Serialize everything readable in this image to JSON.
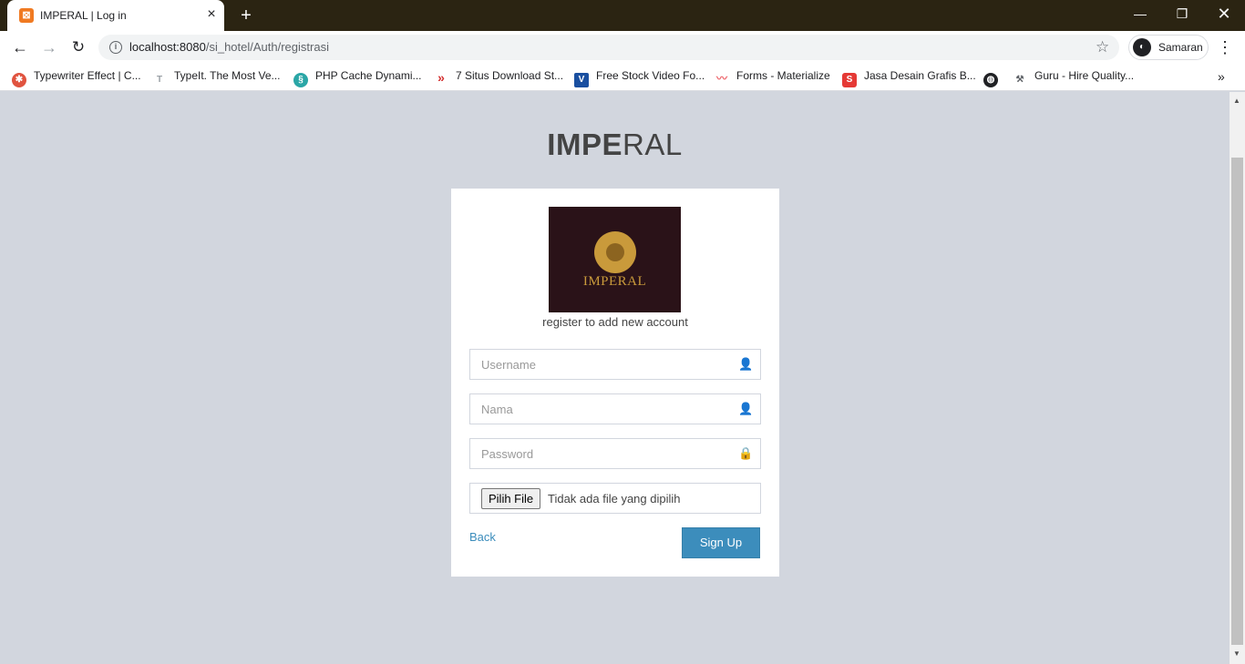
{
  "browser": {
    "tab_title": "IMPERAL | Log in",
    "tab_favicon": "xampp-icon",
    "url_host": "localhost:8080",
    "url_path": "/si_hotel/Auth/registrasi",
    "profile_label": "Samaran"
  },
  "bookmarks": [
    {
      "label": "Typewriter Effect | C...",
      "icon": "codepen-icon",
      "color": "#e0533f"
    },
    {
      "label": "TypeIt. The Most Ve...",
      "icon": "typeit-icon",
      "color": "#9aa0a6"
    },
    {
      "label": "PHP Cache Dynami...",
      "icon": "php-icon",
      "color": "#2aa6a6"
    },
    {
      "label": "7 Situs Download St...",
      "icon": "chevron-red-icon",
      "color": "#d32f2f"
    },
    {
      "label": "Free Stock Video Fo...",
      "icon": "videvo-icon",
      "color": "#1a4fa0"
    },
    {
      "label": "Forms - Materialize",
      "icon": "materialize-icon",
      "color": "#ee6e73"
    },
    {
      "label": "Jasa Desain Grafis B...",
      "icon": "sribu-icon",
      "color": "#e53935"
    },
    {
      "label": "",
      "icon": "globe-icon",
      "color": "#202124"
    },
    {
      "label": "Guru - Hire Quality...",
      "icon": "guru-icon",
      "color": "#5f6368"
    }
  ],
  "page": {
    "brand_bold": "IMPE",
    "brand_light": "RAL",
    "logo_text": "IMPERAL",
    "message": "register to add new account",
    "username_placeholder": "Username",
    "nama_placeholder": "Nama",
    "password_placeholder": "Password",
    "file_button": "Pilih File",
    "file_status": "Tidak ada file yang dipilih",
    "back_label": "Back",
    "signup_label": "Sign Up"
  },
  "colors": {
    "page_bg": "#d2d6de",
    "primary": "#3c8dbc",
    "logo_bg": "#2a1218",
    "logo_gold": "#c99a3b"
  }
}
